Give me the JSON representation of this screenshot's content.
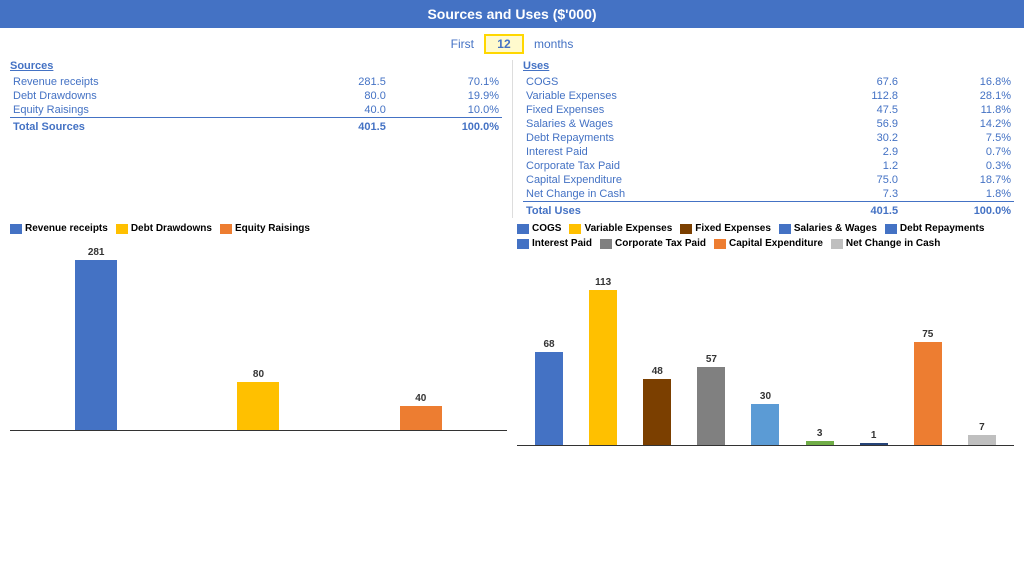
{
  "title": "Sources and Uses ($'000)",
  "months_label_pre": "First",
  "months_value": "12",
  "months_label_post": "months",
  "sources": {
    "heading": "Sources",
    "rows": [
      {
        "label": "Revenue receipts",
        "value": "281.5",
        "pct": "70.1%"
      },
      {
        "label": "Debt Drawdowns",
        "value": "80.0",
        "pct": "19.9%"
      },
      {
        "label": "Equity Raisings",
        "value": "40.0",
        "pct": "10.0%"
      }
    ],
    "total_label": "Total Sources",
    "total_value": "401.5",
    "total_pct": "100.0%"
  },
  "uses": {
    "heading": "Uses",
    "rows": [
      {
        "label": "COGS",
        "value": "67.6",
        "pct": "16.8%"
      },
      {
        "label": "Variable Expenses",
        "value": "112.8",
        "pct": "28.1%"
      },
      {
        "label": "Fixed Expenses",
        "value": "47.5",
        "pct": "11.8%"
      },
      {
        "label": "Salaries & Wages",
        "value": "56.9",
        "pct": "14.2%"
      },
      {
        "label": "Debt Repayments",
        "value": "30.2",
        "pct": "7.5%"
      },
      {
        "label": "Interest Paid",
        "value": "2.9",
        "pct": "0.7%"
      },
      {
        "label": "Corporate Tax Paid",
        "value": "1.2",
        "pct": "0.3%"
      },
      {
        "label": "Capital Expenditure",
        "value": "75.0",
        "pct": "18.7%"
      },
      {
        "label": "Net Change in Cash",
        "value": "7.3",
        "pct": "1.8%"
      }
    ],
    "total_label": "Total Uses",
    "total_value": "401.5",
    "total_pct": "100.0%"
  },
  "left_chart": {
    "legend": [
      {
        "label": "Revenue receipts",
        "color": "#4472C4"
      },
      {
        "label": "Debt Drawdowns",
        "color": "#FFC000"
      },
      {
        "label": "Equity Raisings",
        "color": "#ED7D31"
      }
    ],
    "bars": [
      {
        "label": "281",
        "value": 281,
        "color": "#4472C4"
      },
      {
        "label": "80",
        "value": 80,
        "color": "#FFC000"
      },
      {
        "label": "40",
        "value": 40,
        "color": "#ED7D31"
      }
    ]
  },
  "right_chart": {
    "legend": [
      {
        "label": "COGS",
        "color": "#4472C4"
      },
      {
        "label": "Variable Expenses",
        "color": "#FFC000"
      },
      {
        "label": "Fixed Expenses",
        "color": "#7B3F00"
      },
      {
        "label": "Salaries & Wages",
        "color": "#4472C4"
      },
      {
        "label": "Debt Repayments",
        "color": "#4472C4"
      },
      {
        "label": "Interest Paid",
        "color": "#4472C4"
      },
      {
        "label": "Corporate Tax Paid",
        "color": "#4472C4"
      },
      {
        "label": "Capital Expenditure",
        "color": "#ED7D31"
      },
      {
        "label": "Net Change in Cash",
        "color": "#BFBFBF"
      }
    ],
    "bars": [
      {
        "label": "68",
        "value": 68,
        "color": "#4472C4"
      },
      {
        "label": "113",
        "value": 113,
        "color": "#FFC000"
      },
      {
        "label": "48",
        "value": 48,
        "color": "#7B3F00"
      },
      {
        "label": "57",
        "value": 57,
        "color": "#808080"
      },
      {
        "label": "30",
        "value": 30,
        "color": "#5B9BD5"
      },
      {
        "label": "3",
        "value": 3,
        "color": "#70AD47"
      },
      {
        "label": "1",
        "value": 1,
        "color": "#264478"
      },
      {
        "label": "75",
        "value": 75,
        "color": "#ED7D31"
      },
      {
        "label": "7",
        "value": 7,
        "color": "#BFBFBF"
      }
    ]
  }
}
